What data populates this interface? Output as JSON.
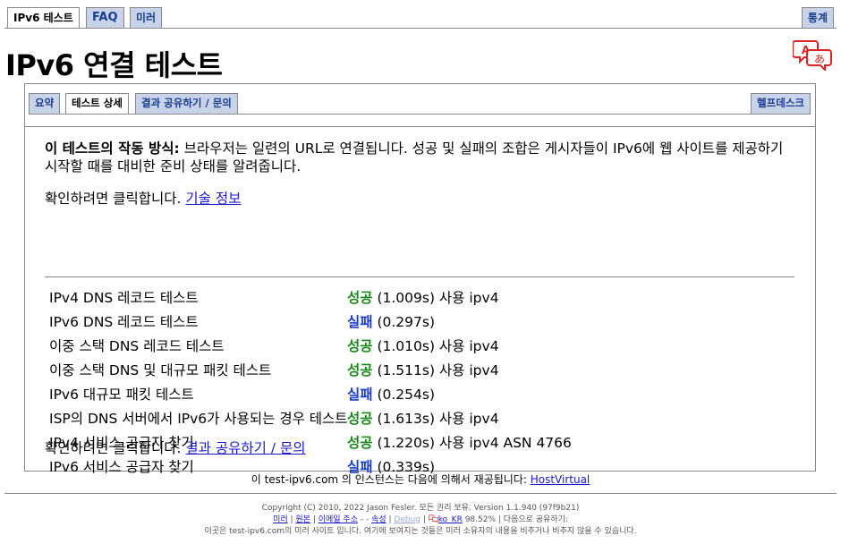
{
  "top_tabs": {
    "ipv6_test": "IPv6 테스트",
    "faq": "FAQ",
    "mirror": "미러",
    "stats": "통계"
  },
  "page_title": "IPv6 연결 테스트",
  "sub_tabs": {
    "summary": "요약",
    "details": "테스트 상세",
    "share": "결과 공유하기 / 문의",
    "helpdesk": "헬프데스크"
  },
  "intro": {
    "bold": "이 테스트의 작동 방식:",
    "text": " 브라우저는 일련의 URL로 연결됩니다. 성공 및 실패의 조합은 게시자들이 IPv6에 웹 사이트를 제공하기 시작할 때를 대비한 준비 상태를 알려줍니다."
  },
  "click_tech": {
    "prefix": "확인하려면 클릭합니다. ",
    "link": "기술 정보"
  },
  "tests": [
    {
      "label": "IPv4 DNS 레코드 테스트",
      "status": "성공",
      "detail": " (1.009s) 사용 ipv4"
    },
    {
      "label": "IPv6 DNS 레코드 테스트",
      "status": "실패",
      "detail": " (0.297s)"
    },
    {
      "label": "이중 스택 DNS 레코드 테스트",
      "status": "성공",
      "detail": " (1.010s) 사용 ipv4"
    },
    {
      "label": "이중 스택 DNS 및 대규모 패킷 테스트",
      "status": "성공",
      "detail": " (1.511s) 사용 ipv4"
    },
    {
      "label": "IPv6 대규모 패킷 테스트",
      "status": "실패",
      "detail": " (0.254s)"
    },
    {
      "label": "ISP의 DNS 서버에서 IPv6가 사용되는 경우 테스트",
      "status": "성공",
      "detail": " (1.613s) 사용 ipv4"
    },
    {
      "label": "IPv4 서비스 공급자 찾기",
      "status": "성공",
      "detail": " (1.220s) 사용 ipv4 ASN 4766"
    },
    {
      "label": "IPv6 서비스 공급자 찾기",
      "status": "실패",
      "detail": " (0.339s)"
    }
  ],
  "click_share": {
    "prefix": "확인하려면 클릭합니다. ",
    "link": "결과 공유하기 / 문의"
  },
  "hosted": {
    "text": "이 test-ipv6.com 의 인스턴스는 다음에 의해서 재공됩니다: ",
    "link": "HostVirtual"
  },
  "footer": {
    "copyright": "Copyright (C) 2010, 2022 Jason Fesler. 모든 권리 보유. Version 1.1.940 (97f9b21)",
    "links": {
      "mirror": "미러",
      "source": "원본",
      "email": "이메일 주소",
      "dash1": " - ",
      "dash2": " - ",
      "attribution": "속성",
      "debug": "Debug",
      "locale": "ko_KR",
      "percent": " 98.52% | 다음으로 공유하기:"
    },
    "disclaimer": "이곳은 test-ipv6.com의 미러 사이트 입니다. 여기에 보여지는 것들은 미러 소유자의 내용을 비추거나 비추지 않을 수 있습니다."
  },
  "colors": {
    "success": "#1b8a1b",
    "fail": "#1a3dcc",
    "link": "#1a1acc",
    "tab_bg": "#c8d3ea"
  }
}
